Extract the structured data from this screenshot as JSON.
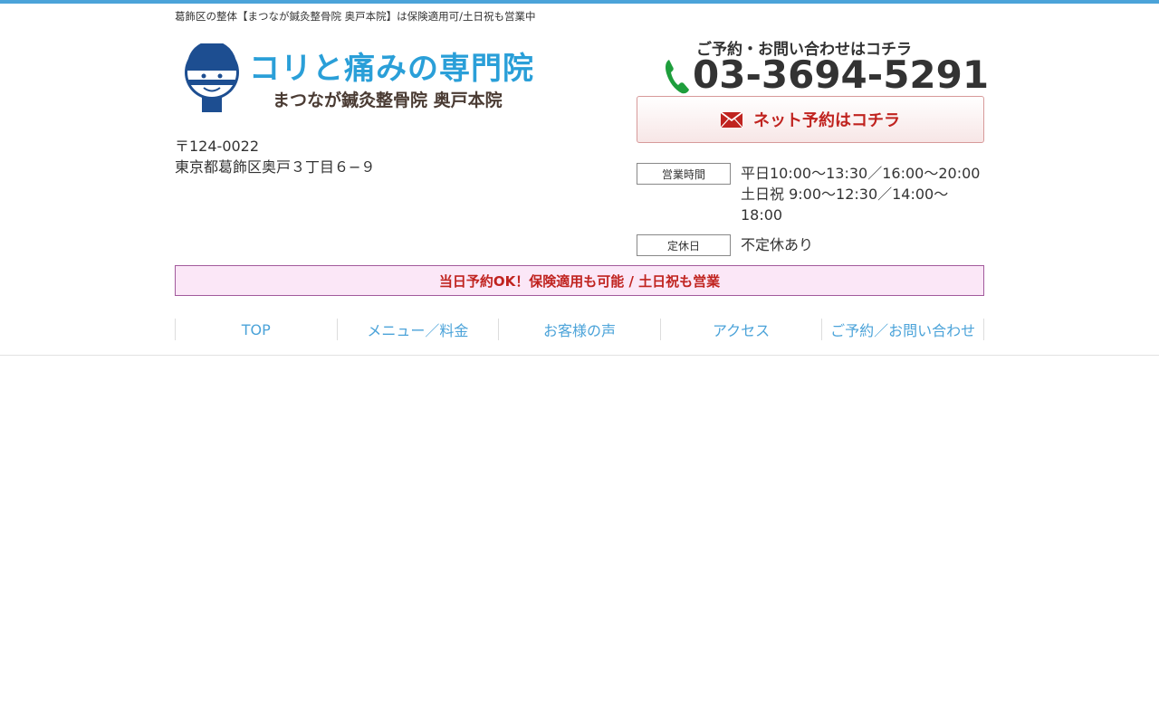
{
  "header": {
    "tagline": "葛飾区の整体【まつなが鍼灸整骨院 奥戸本院】は保険適用可/土日祝も営業中",
    "logo": {
      "title": "コリと痛みの専門院",
      "subtitle": "まつなが鍼灸整骨院 奥戸本院"
    },
    "address": {
      "postal": "〒124-0022",
      "street": "東京都葛飾区奥戸３丁目６−９"
    },
    "contact": {
      "label": "ご予約・お問い合わせはコチラ",
      "phone": "03-3694-5291",
      "net_reservation": "ネット予約はコチラ"
    },
    "hours": {
      "tag": "営業時間",
      "weekday": "平日10:00〜13:30／16:00〜20:00",
      "weekend": "土日祝 9:00〜12:30／14:00〜18:00"
    },
    "holiday": {
      "tag": "定休日",
      "text": "不定休あり"
    },
    "banner": "当日予約OK！保険適用も可能 / 土日祝も営業"
  },
  "nav": {
    "items": [
      {
        "label": "TOP"
      },
      {
        "label": "メニュー／料金"
      },
      {
        "label": "お客様の声"
      },
      {
        "label": "アクセス"
      },
      {
        "label": "ご予約／お問い合わせ"
      }
    ]
  },
  "colors": {
    "accent": "#4ba3d9",
    "logo_blue": "#2a9fd8",
    "cta_red": "#c0231f",
    "banner_bg": "#fbe7f7",
    "banner_border": "#a25a9c"
  },
  "icons": {
    "phone": "phone-icon",
    "mail": "mail-icon",
    "logo_mascot": "mascot-face-icon"
  }
}
